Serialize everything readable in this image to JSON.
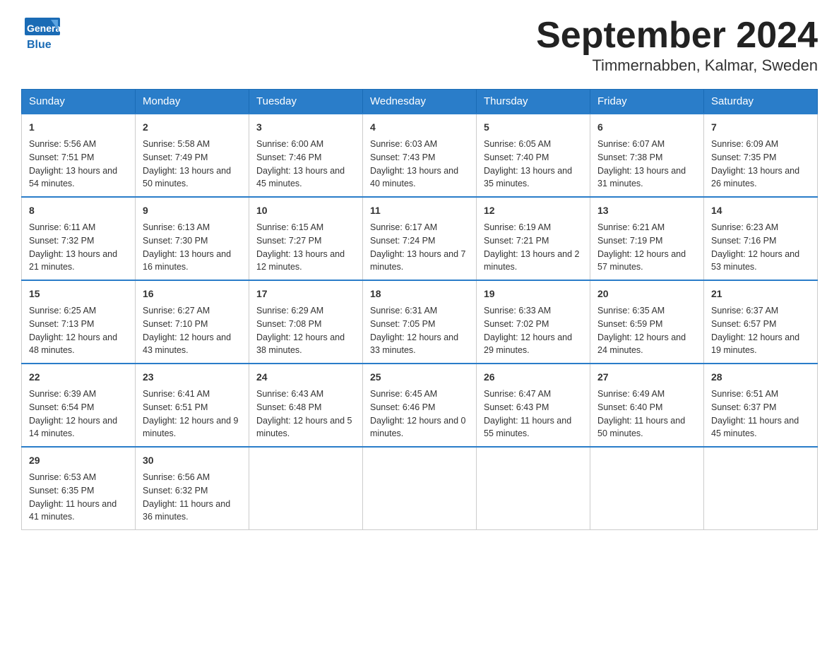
{
  "header": {
    "logo_line1": "General",
    "logo_line2": "Blue",
    "month_title": "September 2024",
    "location": "Timmernabben, Kalmar, Sweden"
  },
  "weekdays": [
    "Sunday",
    "Monday",
    "Tuesday",
    "Wednesday",
    "Thursday",
    "Friday",
    "Saturday"
  ],
  "weeks": [
    [
      {
        "day": "1",
        "sunrise": "5:56 AM",
        "sunset": "7:51 PM",
        "daylight": "13 hours and 54 minutes."
      },
      {
        "day": "2",
        "sunrise": "5:58 AM",
        "sunset": "7:49 PM",
        "daylight": "13 hours and 50 minutes."
      },
      {
        "day": "3",
        "sunrise": "6:00 AM",
        "sunset": "7:46 PM",
        "daylight": "13 hours and 45 minutes."
      },
      {
        "day": "4",
        "sunrise": "6:03 AM",
        "sunset": "7:43 PM",
        "daylight": "13 hours and 40 minutes."
      },
      {
        "day": "5",
        "sunrise": "6:05 AM",
        "sunset": "7:40 PM",
        "daylight": "13 hours and 35 minutes."
      },
      {
        "day": "6",
        "sunrise": "6:07 AM",
        "sunset": "7:38 PM",
        "daylight": "13 hours and 31 minutes."
      },
      {
        "day": "7",
        "sunrise": "6:09 AM",
        "sunset": "7:35 PM",
        "daylight": "13 hours and 26 minutes."
      }
    ],
    [
      {
        "day": "8",
        "sunrise": "6:11 AM",
        "sunset": "7:32 PM",
        "daylight": "13 hours and 21 minutes."
      },
      {
        "day": "9",
        "sunrise": "6:13 AM",
        "sunset": "7:30 PM",
        "daylight": "13 hours and 16 minutes."
      },
      {
        "day": "10",
        "sunrise": "6:15 AM",
        "sunset": "7:27 PM",
        "daylight": "13 hours and 12 minutes."
      },
      {
        "day": "11",
        "sunrise": "6:17 AM",
        "sunset": "7:24 PM",
        "daylight": "13 hours and 7 minutes."
      },
      {
        "day": "12",
        "sunrise": "6:19 AM",
        "sunset": "7:21 PM",
        "daylight": "13 hours and 2 minutes."
      },
      {
        "day": "13",
        "sunrise": "6:21 AM",
        "sunset": "7:19 PM",
        "daylight": "12 hours and 57 minutes."
      },
      {
        "day": "14",
        "sunrise": "6:23 AM",
        "sunset": "7:16 PM",
        "daylight": "12 hours and 53 minutes."
      }
    ],
    [
      {
        "day": "15",
        "sunrise": "6:25 AM",
        "sunset": "7:13 PM",
        "daylight": "12 hours and 48 minutes."
      },
      {
        "day": "16",
        "sunrise": "6:27 AM",
        "sunset": "7:10 PM",
        "daylight": "12 hours and 43 minutes."
      },
      {
        "day": "17",
        "sunrise": "6:29 AM",
        "sunset": "7:08 PM",
        "daylight": "12 hours and 38 minutes."
      },
      {
        "day": "18",
        "sunrise": "6:31 AM",
        "sunset": "7:05 PM",
        "daylight": "12 hours and 33 minutes."
      },
      {
        "day": "19",
        "sunrise": "6:33 AM",
        "sunset": "7:02 PM",
        "daylight": "12 hours and 29 minutes."
      },
      {
        "day": "20",
        "sunrise": "6:35 AM",
        "sunset": "6:59 PM",
        "daylight": "12 hours and 24 minutes."
      },
      {
        "day": "21",
        "sunrise": "6:37 AM",
        "sunset": "6:57 PM",
        "daylight": "12 hours and 19 minutes."
      }
    ],
    [
      {
        "day": "22",
        "sunrise": "6:39 AM",
        "sunset": "6:54 PM",
        "daylight": "12 hours and 14 minutes."
      },
      {
        "day": "23",
        "sunrise": "6:41 AM",
        "sunset": "6:51 PM",
        "daylight": "12 hours and 9 minutes."
      },
      {
        "day": "24",
        "sunrise": "6:43 AM",
        "sunset": "6:48 PM",
        "daylight": "12 hours and 5 minutes."
      },
      {
        "day": "25",
        "sunrise": "6:45 AM",
        "sunset": "6:46 PM",
        "daylight": "12 hours and 0 minutes."
      },
      {
        "day": "26",
        "sunrise": "6:47 AM",
        "sunset": "6:43 PM",
        "daylight": "11 hours and 55 minutes."
      },
      {
        "day": "27",
        "sunrise": "6:49 AM",
        "sunset": "6:40 PM",
        "daylight": "11 hours and 50 minutes."
      },
      {
        "day": "28",
        "sunrise": "6:51 AM",
        "sunset": "6:37 PM",
        "daylight": "11 hours and 45 minutes."
      }
    ],
    [
      {
        "day": "29",
        "sunrise": "6:53 AM",
        "sunset": "6:35 PM",
        "daylight": "11 hours and 41 minutes."
      },
      {
        "day": "30",
        "sunrise": "6:56 AM",
        "sunset": "6:32 PM",
        "daylight": "11 hours and 36 minutes."
      },
      null,
      null,
      null,
      null,
      null
    ]
  ],
  "labels": {
    "sunrise": "Sunrise:",
    "sunset": "Sunset:",
    "daylight": "Daylight:"
  }
}
